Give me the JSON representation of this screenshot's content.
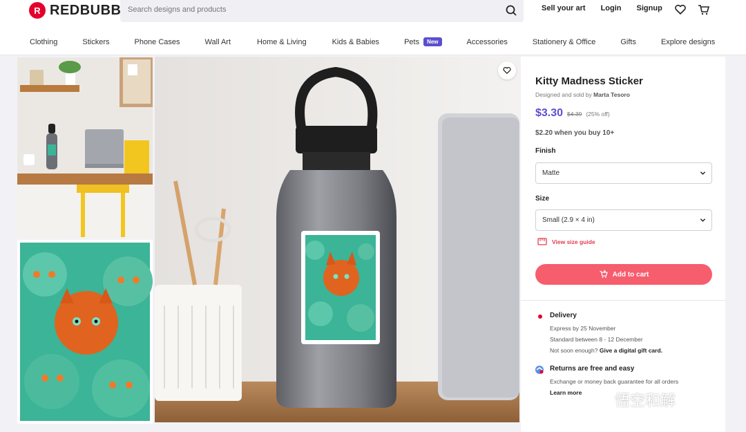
{
  "header": {
    "logo_text": "REDBUBBLE",
    "search_placeholder": "Search designs and products",
    "links": [
      "Sell your art",
      "Login",
      "Signup"
    ],
    "icons": [
      "heart-icon",
      "cart-icon"
    ]
  },
  "nav": [
    {
      "label": "Clothing"
    },
    {
      "label": "Stickers"
    },
    {
      "label": "Phone Cases"
    },
    {
      "label": "Wall Art"
    },
    {
      "label": "Home & Living"
    },
    {
      "label": "Kids & Babies"
    },
    {
      "label": "Pets",
      "badge": "New"
    },
    {
      "label": "Accessories"
    },
    {
      "label": "Stationery & Office"
    },
    {
      "label": "Gifts"
    },
    {
      "label": "Explore designs"
    }
  ],
  "product": {
    "title": "Kitty Madness Sticker",
    "designed_prefix": "Designed and sold by",
    "artist": "Marta Tesoro",
    "price": "$3.30",
    "old_price": "$4.39",
    "discount": "(25% off)",
    "bulk": "$2.20 when you buy 10+",
    "finish_label": "Finish",
    "finish_value": "Matte",
    "size_label": "Size",
    "size_value": "Small (2.9 × 4 in)",
    "size_guide": "View size guide",
    "add_to_cart": "Add to cart"
  },
  "delivery": {
    "title": "Delivery",
    "express": "Express by 25 November",
    "standard": "Standard between 8 - 12 December",
    "not_soon": "Not soon enough?",
    "gift_card": "Give a digital gift card."
  },
  "returns": {
    "title": "Returns are free and easy",
    "sub": "Exchange or money back guarantee for all orders",
    "learn_more": "Learn more"
  },
  "watermark": "悟空和解",
  "colors": {
    "brand": "#e4002b",
    "accent": "#5b4fcf",
    "cart": "#f65d6d",
    "sticker_bg": "#3bb497"
  }
}
